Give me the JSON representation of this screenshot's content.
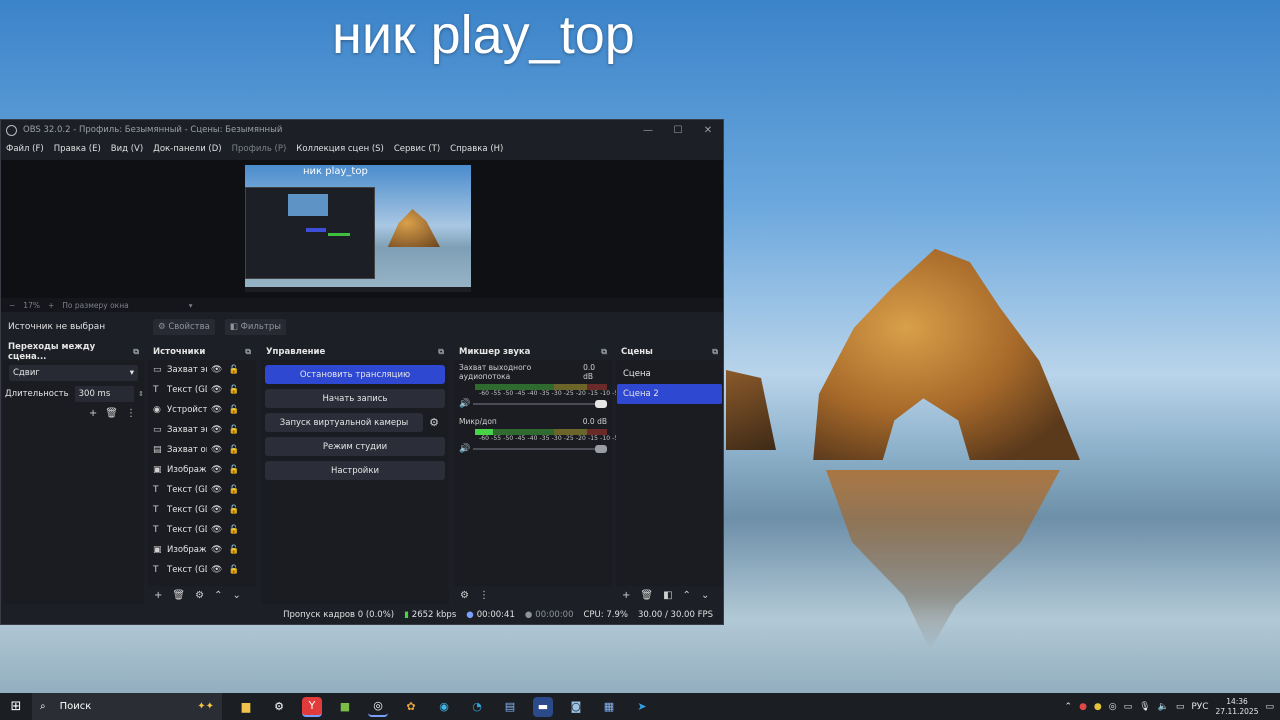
{
  "desktop": {
    "title": "ник play_top"
  },
  "window": {
    "title": "OBS 32.0.2 - Профиль: Безымянный - Сцены: Безымянный",
    "min": "—",
    "max": "☐",
    "close": "✕"
  },
  "menu": [
    "Файл (F)",
    "Правка (E)",
    "Вид (V)",
    "Док-панели (D)",
    "Профиль (P)",
    "Коллекция сцен (S)",
    "Сервис (T)",
    "Справка (H)"
  ],
  "preview": {
    "thumb_title": "ник play_top",
    "zoom": "17%",
    "fit": "По размеру окна"
  },
  "source_bar": {
    "none": "Источник не выбран",
    "props": "Свойства",
    "filters": "Фильтры"
  },
  "transitions": {
    "title": "Переходы между сцена...",
    "type": "Сдвиг",
    "duration_label": "Длительность",
    "duration": "300 ms"
  },
  "sources": {
    "title": "Источники",
    "items": [
      {
        "name": "Захват экр",
        "icon": "▭"
      },
      {
        "name": "Текст (GDI",
        "icon": "T"
      },
      {
        "name": "Устройств",
        "icon": "◉"
      },
      {
        "name": "Захват экр",
        "icon": "▭"
      },
      {
        "name": "Захват окн",
        "icon": "▤"
      },
      {
        "name": "Изображе",
        "icon": "▣"
      },
      {
        "name": "Текст (GDI",
        "icon": "T"
      },
      {
        "name": "Текст (GDI",
        "icon": "T"
      },
      {
        "name": "Текст (GDI",
        "icon": "T"
      },
      {
        "name": "Изображе",
        "icon": "▣"
      },
      {
        "name": "Текст (GDI",
        "icon": "T"
      }
    ]
  },
  "controls": {
    "title": "Управление",
    "stop_stream": "Остановить трансляцию",
    "start_record": "Начать запись",
    "virtual_cam": "Запуск виртуальной камеры",
    "studio_mode": "Режим студии",
    "settings": "Настройки"
  },
  "mixer": {
    "title": "Микшер звука",
    "channels": [
      {
        "name": "Захват выходного аудиопотока",
        "db": "0.0 dB",
        "level": 0.0
      },
      {
        "name": "Микр/доп",
        "db": "0.0 dB",
        "level": 0.14
      }
    ],
    "scale": "-60 -55 -50 -45 -40 -35 -30 -25 -20 -15 -10 -5 0"
  },
  "scenes": {
    "title": "Сцены",
    "items": [
      "Сцена",
      "Сцена 2"
    ],
    "selected": 1
  },
  "status": {
    "dropped": "Пропуск кадров 0 (0.0%)",
    "bitrate": "2652 kbps",
    "stream_time": "00:00:41",
    "rec_time": "00:00:00",
    "cpu": "CPU: 7.9%",
    "fps": "30.00 / 30.00 FPS"
  },
  "taskbar": {
    "search": "Поиск",
    "lang": "РУС",
    "time": "14:36",
    "date": "27.11.2025"
  }
}
